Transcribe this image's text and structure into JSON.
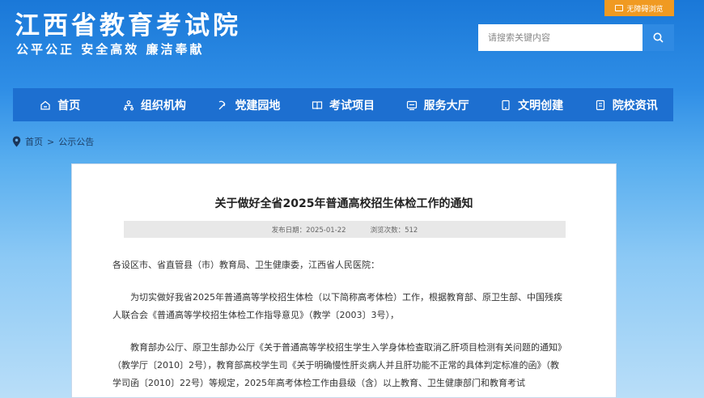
{
  "header": {
    "title": "江西省教育考试院",
    "slogan": "公平公正 安全高效 廉洁奉献",
    "accessibility_label": "无障碍浏览",
    "search_placeholder": "请搜索关键内容"
  },
  "nav": {
    "items": [
      {
        "label": "首页",
        "icon": "home-icon"
      },
      {
        "label": "组织机构",
        "icon": "org-chart-icon"
      },
      {
        "label": "党建园地",
        "icon": "party-badge-icon"
      },
      {
        "label": "考试项目",
        "icon": "open-book-icon"
      },
      {
        "label": "服务大厅",
        "icon": "service-window-icon"
      },
      {
        "label": "文明创建",
        "icon": "tablet-icon"
      },
      {
        "label": "院校资讯",
        "icon": "document-icon"
      }
    ]
  },
  "breadcrumb": {
    "home": "首页",
    "separator": ">",
    "current": "公示公告"
  },
  "article": {
    "title": "关于做好全省2025年普通高校招生体检工作的通知",
    "publish_date": "发布日期：2025-01-22",
    "views": "浏览次数：512",
    "paragraphs": [
      "各设区市、省直管县（市）教育局、卫生健康委，江西省人民医院：",
      "为切实做好我省2025年普通高等学校招生体检（以下简称高考体检）工作，根据教育部、原卫生部、中国残疾人联合会《普通高等学校招生体检工作指导意见》（教学〔2003〕3号），",
      "教育部办公厅、原卫生部办公厅《关于普通高等学校招生学生入学身体检查取消乙肝项目检测有关问题的通知》（教学厅〔2010〕2号），教育部高校学生司《关于明确慢性肝炎病人并且肝功能不正常的具体判定标准的函》（教学司函〔2010〕22号）等规定，2025年高考体检工作由县级（含）以上教育、卫生健康部门和教育考试"
    ]
  },
  "colors": {
    "primary": "#1d6fd0",
    "accent_orange": "#f09a22",
    "search_button": "#2f8ae3"
  }
}
